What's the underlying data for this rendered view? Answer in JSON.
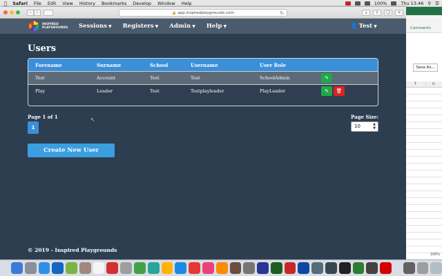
{
  "menubar": {
    "app": "Safari",
    "items": [
      "File",
      "Edit",
      "View",
      "History",
      "Bookmarks",
      "Develop",
      "Window",
      "Help"
    ],
    "battery": "100%",
    "clock": "Thu 13:46"
  },
  "browser": {
    "url": "app.inspiredplaygrounds.com"
  },
  "site": {
    "brand_line1": "INSPIRED",
    "brand_line2": "PLAYGROUNDS",
    "nav": [
      "Sessions",
      "Registers",
      "Admin",
      "Help"
    ],
    "user": "Test"
  },
  "page": {
    "title": "Users",
    "columns": [
      "Forename",
      "Surname",
      "School",
      "Username",
      "User Role"
    ],
    "rows": [
      {
        "forename": "Test",
        "surname": "Account",
        "school": "Test",
        "username": "Test",
        "role": "SchoolAdmin",
        "actions": [
          "edit"
        ]
      },
      {
        "forename": "Play",
        "surname": "Leader",
        "school": "Test",
        "username": "Testplayleader",
        "role": "PlayLeader",
        "actions": [
          "edit",
          "delete"
        ]
      }
    ],
    "page_info": "Page 1 of 1",
    "current_page": "1",
    "page_size_label": "Page Size:",
    "page_size": "10",
    "create_button": "Create New User",
    "footer": "© 2019 - Inspired Playgrounds"
  },
  "excel": {
    "comments": "Comments",
    "save_as": "Save As...",
    "col_t": "T",
    "col_u": "U",
    "zoom": "100%"
  },
  "colors": {
    "page_bg": "#2c3e50",
    "header_bg": "#4a5b6d",
    "table_header": "#3b8fd8",
    "edit_button": "#1fa84a",
    "delete_button": "#e02020",
    "create_button": "#3b9ee0"
  },
  "icons": [
    "apple-icon",
    "search-icon",
    "edit-icon",
    "delete-icon",
    "user-icon",
    "chevron-down-icon"
  ]
}
